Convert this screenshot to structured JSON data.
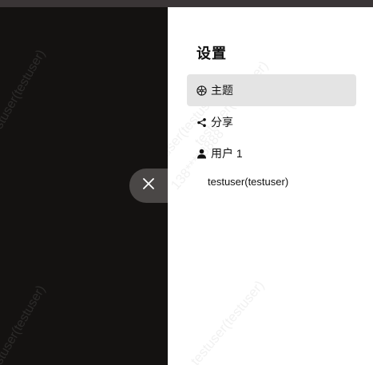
{
  "panel": {
    "title": "设置",
    "menu": [
      {
        "label": "主题",
        "icon": "palette-icon",
        "active": true
      },
      {
        "label": "分享",
        "icon": "share-icon",
        "active": false
      },
      {
        "label": "用户 1",
        "icon": "user-icon",
        "active": false
      }
    ],
    "user_entry": "testuser(testuser)"
  },
  "watermark": {
    "user": "testuser(testuser)",
    "phone": "138****8888"
  },
  "colors": {
    "topbar": "#3a3536",
    "backdrop": "#141211",
    "active_item_bg": "#e4e4e4",
    "close_tab_bg": "#4a4746"
  }
}
